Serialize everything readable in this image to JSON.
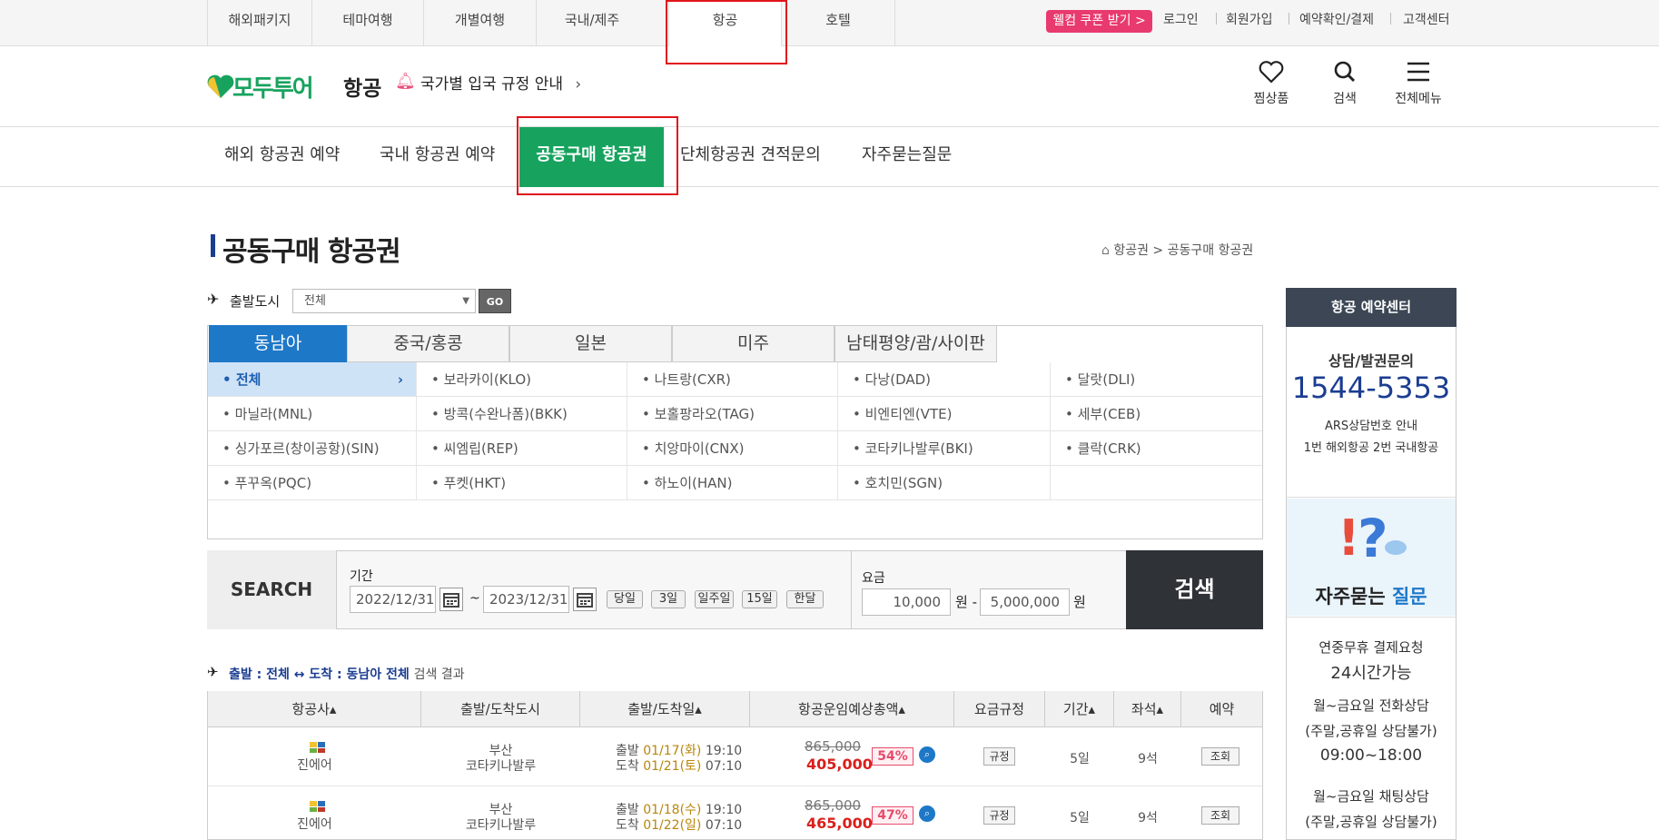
{
  "topnav": {
    "tabs": [
      "해외패키지",
      "테마여행",
      "개별여행",
      "국내/제주",
      "항공",
      "호텔"
    ],
    "coupon": "웰컴 쿠폰 받기 >",
    "util": [
      "로그인",
      "회원가입",
      "예약확인/결제",
      "고객센터"
    ]
  },
  "header": {
    "logo": "모두투어",
    "section": "항공",
    "notice": "국가별 입국 규정 안내",
    "icons": {
      "wish": "찜상품",
      "search": "검색",
      "menu": "전체메뉴"
    }
  },
  "subnav": [
    "해외 항공권 예약",
    "국내 항공권 예약",
    "공동구매 항공권",
    "단체항공권 견적문의",
    "자주묻는질문"
  ],
  "page": {
    "title": "공동구매 항공권",
    "breadcrumb": "항공권 > 공동구매 항공권"
  },
  "filter": {
    "city_label": "출발도시",
    "city_value": "전체",
    "go": "GO"
  },
  "regions": [
    "동남아",
    "중국/홍콩",
    "일본",
    "미주",
    "남태평양/괌/사이판"
  ],
  "destinations": [
    [
      "전체",
      "보라카이(KLO)",
      "나트랑(CXR)",
      "다낭(DAD)",
      "달랏(DLI)"
    ],
    [
      "마닐라(MNL)",
      "방콕(수완나폼)(BKK)",
      "보홀팡라오(TAG)",
      "비엔티엔(VTE)",
      "세부(CEB)"
    ],
    [
      "싱가포르(창이공항)(SIN)",
      "씨엠립(REP)",
      "치앙마이(CNX)",
      "코타키나발루(BKI)",
      "클락(CRK)"
    ],
    [
      "푸꾸옥(PQC)",
      "푸켓(HKT)",
      "하노이(HAN)",
      "호치민(SGN)",
      ""
    ]
  ],
  "search": {
    "label": "SEARCH",
    "period_label": "기간",
    "date_from": "2022/12/31",
    "tilde": "~",
    "date_to": "2023/12/31",
    "quick": [
      "당일",
      "3일",
      "일주일",
      "15일",
      "한달"
    ],
    "fare_label": "요금",
    "fare_min": "10,000",
    "won1": "원 -",
    "fare_max": "5,000,000",
    "won2": "원",
    "button": "검색"
  },
  "result": {
    "prefix": "출발 : 전체 ↔ 도착 : 동남아 전체",
    "suffix": "검색 결과",
    "headers": [
      "항공사▴",
      "출발/도착도시",
      "출발/도착일▴",
      "항공운임예상총액▴",
      "요금규정",
      "기간▴",
      "좌석▴",
      "예약"
    ],
    "rows": [
      {
        "airline": "진에어",
        "from": "부산",
        "to": "코타키나발루",
        "dep_label": "출발",
        "dep_date": "01/17(화)",
        "dep_time": "19:10",
        "arr_label": "도착",
        "arr_date": "01/21(토)",
        "arr_time": "07:10",
        "orig": "865,000",
        "price": "405,000",
        "pct": "54%",
        "rule": "규정",
        "period": "5일",
        "seats": "9석",
        "book": "조회"
      },
      {
        "airline": "진에어",
        "from": "부산",
        "to": "코타키나발루",
        "dep_label": "출발",
        "dep_date": "01/18(수)",
        "dep_time": "19:10",
        "arr_label": "도착",
        "arr_date": "01/22(일)",
        "arr_time": "07:10",
        "orig": "865,000",
        "price": "465,000",
        "pct": "47%",
        "rule": "규정",
        "period": "5일",
        "seats": "9석",
        "book": "조회"
      }
    ]
  },
  "sidebar": {
    "title": "항공 예약센터",
    "consult": "상담/발권문의",
    "phone": "1544-5353",
    "ars": "ARS상담번호 안내",
    "ars2": "1번 해외항공 2번 국내항공",
    "faq_a": "자주묻는",
    "faq_b": "질문",
    "pay1": "연중무휴 결제요청",
    "pay2": "24시간가능",
    "tel1": "월~금요일 전화상담",
    "tel2": "(주말,공휴일 상담불가)",
    "tel3": "09:00~18:00",
    "chat1": "월~금요일 채팅상담",
    "chat2": "(주말,공휴일 상담불가)"
  },
  "colors": {
    "brand_green": "#17a35e",
    "region_blue": "#1e78c8",
    "price_red": "#d9201c"
  }
}
